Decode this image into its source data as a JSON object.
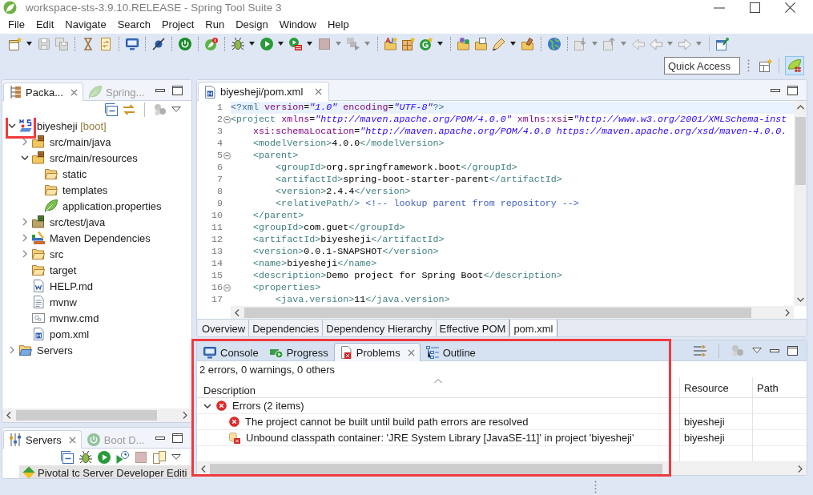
{
  "window": {
    "title": "workspace-sts-3.9.10.RELEASE - Spring Tool Suite 3"
  },
  "menu": [
    "File",
    "Edit",
    "Navigate",
    "Search",
    "Project",
    "Run",
    "Design",
    "Window",
    "Help"
  ],
  "quick_access": {
    "placeholder": "Quick Access"
  },
  "perspectives": [
    {
      "selected": true
    }
  ],
  "package_explorer": {
    "active": false,
    "tabs": [
      {
        "label": "Packa...",
        "kind": "package-explorer",
        "selected": true
      },
      {
        "label": "Spring...",
        "kind": "spring-explorer",
        "selected": false
      }
    ],
    "tree": [
      {
        "label": "biyesheji",
        "suffix": "[boot]",
        "kind": "project",
        "expanded": true,
        "highlighted": true,
        "children": [
          {
            "label": "src/main/java",
            "kind": "source-folder",
            "expanded": false
          },
          {
            "label": "src/main/resources",
            "kind": "source-folder",
            "expanded": true,
            "children": [
              {
                "label": "static",
                "kind": "folder"
              },
              {
                "label": "templates",
                "kind": "folder"
              },
              {
                "label": "application.properties",
                "kind": "spring-properties"
              }
            ]
          },
          {
            "label": "src/test/java",
            "kind": "test-source-folder",
            "expanded": false
          },
          {
            "label": "Maven Dependencies",
            "kind": "library",
            "expanded": false
          },
          {
            "label": "src",
            "kind": "folder",
            "expanded": false
          },
          {
            "label": "target",
            "kind": "folder"
          },
          {
            "label": "HELP.md",
            "kind": "markdown-file"
          },
          {
            "label": "mvnw",
            "kind": "text-file"
          },
          {
            "label": "mvnw.cmd",
            "kind": "script-file"
          },
          {
            "label": "pom.xml",
            "kind": "pom-file"
          }
        ]
      },
      {
        "label": "Servers",
        "kind": "servers-folder",
        "expanded": false
      }
    ]
  },
  "servers_view": {
    "active": false,
    "tabs": [
      {
        "label": "Servers",
        "kind": "servers",
        "selected": true
      },
      {
        "label": "Boot D...",
        "kind": "boot-dashboard",
        "selected": false
      }
    ],
    "servers": [
      {
        "label": "Pivotal tc Server Developer Editi",
        "selected": true
      }
    ]
  },
  "editor": {
    "active": false,
    "tabs": [
      {
        "label": "biyesheji/pom.xml",
        "kind": "pom",
        "selected": true
      }
    ],
    "lines": [
      {
        "number": "1",
        "current": true,
        "foldable": false,
        "tokens": [
          {
            "kind": "pi",
            "text": "<?xml "
          },
          {
            "kind": "attr",
            "text": "version"
          },
          {
            "kind": "punct",
            "text": "="
          },
          {
            "kind": "value",
            "text": "\"1.0\" "
          },
          {
            "kind": "attr",
            "text": "encoding"
          },
          {
            "kind": "punct",
            "text": "="
          },
          {
            "kind": "value",
            "text": "\"UTF-8\""
          },
          {
            "kind": "pi",
            "text": "?>"
          }
        ]
      },
      {
        "number": "2",
        "current": false,
        "foldable": true,
        "tokens": [
          {
            "kind": "tag",
            "text": "<project "
          },
          {
            "kind": "attr",
            "text": "xmlns"
          },
          {
            "kind": "punct",
            "text": "="
          },
          {
            "kind": "value",
            "text": "\"http://maven.apache.org/POM/4.0.0\" "
          },
          {
            "kind": "attr",
            "text": "xmlns:xsi"
          },
          {
            "kind": "punct",
            "text": "="
          },
          {
            "kind": "value",
            "text": "\"http://www.w3.org/2001/XMLSchema-inst"
          }
        ]
      },
      {
        "number": "3",
        "current": false,
        "foldable": false,
        "tokens": [
          {
            "kind": "attr",
            "text": "    xsi:schemaLocation"
          },
          {
            "kind": "punct",
            "text": "="
          },
          {
            "kind": "value",
            "text": "\"http://maven.apache.org/POM/4.0.0 https://maven.apache.org/xsd/maven-4.0.0."
          }
        ]
      },
      {
        "number": "4",
        "current": false,
        "foldable": false,
        "tokens": [
          {
            "kind": "tag",
            "text": "    <modelVersion>"
          },
          {
            "kind": "text",
            "text": "4.0.0"
          },
          {
            "kind": "tag",
            "text": "</modelVersion>"
          }
        ]
      },
      {
        "number": "5",
        "current": false,
        "foldable": true,
        "tokens": [
          {
            "kind": "tag",
            "text": "    <parent>"
          }
        ]
      },
      {
        "number": "6",
        "current": false,
        "foldable": false,
        "tokens": [
          {
            "kind": "tag",
            "text": "        <groupId>"
          },
          {
            "kind": "text",
            "text": "org.springframework.boot"
          },
          {
            "kind": "tag",
            "text": "</groupId>"
          }
        ]
      },
      {
        "number": "7",
        "current": false,
        "foldable": false,
        "tokens": [
          {
            "kind": "tag",
            "text": "        <artifactId>"
          },
          {
            "kind": "text",
            "text": "spring-boot-starter-parent"
          },
          {
            "kind": "tag",
            "text": "</artifactId>"
          }
        ]
      },
      {
        "number": "8",
        "current": false,
        "foldable": false,
        "tokens": [
          {
            "kind": "tag",
            "text": "        <version>"
          },
          {
            "kind": "text",
            "text": "2.4.4"
          },
          {
            "kind": "tag",
            "text": "</version>"
          }
        ]
      },
      {
        "number": "9",
        "current": false,
        "foldable": false,
        "tokens": [
          {
            "kind": "tag",
            "text": "        <relativePath/> "
          },
          {
            "kind": "comment",
            "text": "<!-- lookup parent from repository -->"
          }
        ]
      },
      {
        "number": "10",
        "current": false,
        "foldable": false,
        "tokens": [
          {
            "kind": "tag",
            "text": "    </parent>"
          }
        ]
      },
      {
        "number": "11",
        "current": false,
        "foldable": false,
        "tokens": [
          {
            "kind": "tag",
            "text": "    <groupId>"
          },
          {
            "kind": "text",
            "text": "com.guet"
          },
          {
            "kind": "tag",
            "text": "</groupId>"
          }
        ]
      },
      {
        "number": "12",
        "current": false,
        "foldable": false,
        "tokens": [
          {
            "kind": "tag",
            "text": "    <artifactId>"
          },
          {
            "kind": "text",
            "text": "biyesheji"
          },
          {
            "kind": "tag",
            "text": "</artifactId>"
          }
        ]
      },
      {
        "number": "13",
        "current": false,
        "foldable": false,
        "tokens": [
          {
            "kind": "tag",
            "text": "    <version>"
          },
          {
            "kind": "text",
            "text": "0.0.1-SNAPSHOT"
          },
          {
            "kind": "tag",
            "text": "</version>"
          }
        ]
      },
      {
        "number": "14",
        "current": false,
        "foldable": false,
        "tokens": [
          {
            "kind": "tag",
            "text": "    <name>"
          },
          {
            "kind": "text",
            "text": "biyesheji"
          },
          {
            "kind": "tag",
            "text": "</name>"
          }
        ]
      },
      {
        "number": "15",
        "current": false,
        "foldable": false,
        "tokens": [
          {
            "kind": "tag",
            "text": "    <description>"
          },
          {
            "kind": "text",
            "text": "Demo project for Spring Boot"
          },
          {
            "kind": "tag",
            "text": "</description>"
          }
        ]
      },
      {
        "number": "16",
        "current": false,
        "foldable": true,
        "tokens": [
          {
            "kind": "tag",
            "text": "    <properties>"
          }
        ]
      },
      {
        "number": "17",
        "current": false,
        "foldable": false,
        "tokens": [
          {
            "kind": "tag",
            "text": "        <java.version>"
          },
          {
            "kind": "text",
            "text": "11"
          },
          {
            "kind": "tag",
            "text": "</java.version>"
          }
        ]
      }
    ],
    "page_tabs": [
      {
        "label": "Overview",
        "selected": false
      },
      {
        "label": "Dependencies",
        "selected": false
      },
      {
        "label": "Dependency Hierarchy",
        "selected": false
      },
      {
        "label": "Effective POM",
        "selected": false
      },
      {
        "label": "pom.xml",
        "selected": true
      }
    ]
  },
  "problems_view": {
    "active": true,
    "highlighted": true,
    "tabs": [
      {
        "label": "Console",
        "kind": "console",
        "selected": false
      },
      {
        "label": "Progress",
        "kind": "progress",
        "selected": false
      },
      {
        "label": "Problems",
        "kind": "problems",
        "selected": true
      },
      {
        "label": "Outline",
        "kind": "outline",
        "selected": false
      }
    ],
    "summary": "2 errors, 0 warnings, 0 others",
    "columns": [
      "Description",
      "Resource",
      "Path"
    ],
    "groups": [
      {
        "label": "Errors (2 items)",
        "kind": "error",
        "expanded": true,
        "children": [
          {
            "kind": "error",
            "description": "The project cannot be built until build path errors are resolved",
            "resource": "biyesheji"
          },
          {
            "kind": "classpath-error",
            "description": "Unbound classpath container: 'JRE System Library [JavaSE-11]' in project 'biyesheji'",
            "resource": "biyesheji"
          }
        ]
      }
    ]
  }
}
